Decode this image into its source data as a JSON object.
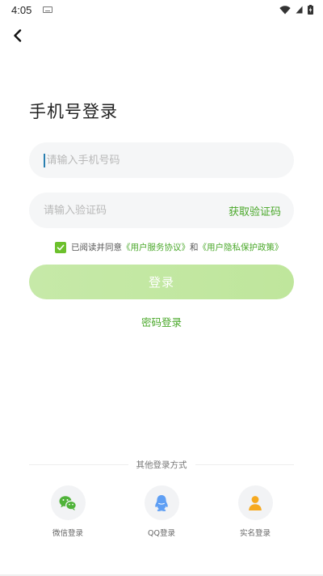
{
  "status_bar": {
    "time": "4:05",
    "icons": [
      "keyboard-icon",
      "wifi-icon",
      "signal-icon",
      "battery-charging-icon"
    ]
  },
  "nav": {
    "back_icon": "chevron-left-icon"
  },
  "title": "手机号登录",
  "phone_input": {
    "placeholder": "请输入手机号码",
    "value": ""
  },
  "code_input": {
    "placeholder": "请输入验证码",
    "value": ""
  },
  "get_code_label": "获取验证码",
  "agreement": {
    "checked": true,
    "prefix": "已阅读并同意",
    "service_link": "《用户服务协议》",
    "conjunction": "和",
    "privacy_link": "《用户隐私保护政策》"
  },
  "login_button": "登录",
  "password_login": "密码登录",
  "other_methods": {
    "heading": "其他登录方式",
    "items": [
      {
        "label": "微信登录",
        "icon": "wechat-icon"
      },
      {
        "label": "QQ登录",
        "icon": "qq-icon"
      },
      {
        "label": "实名登录",
        "icon": "person-icon"
      }
    ]
  },
  "colors": {
    "accent": "#4aa82a",
    "checkbox": "#6cc02c",
    "button": "#c2e7a1",
    "field_bg": "#f5f6f7"
  }
}
